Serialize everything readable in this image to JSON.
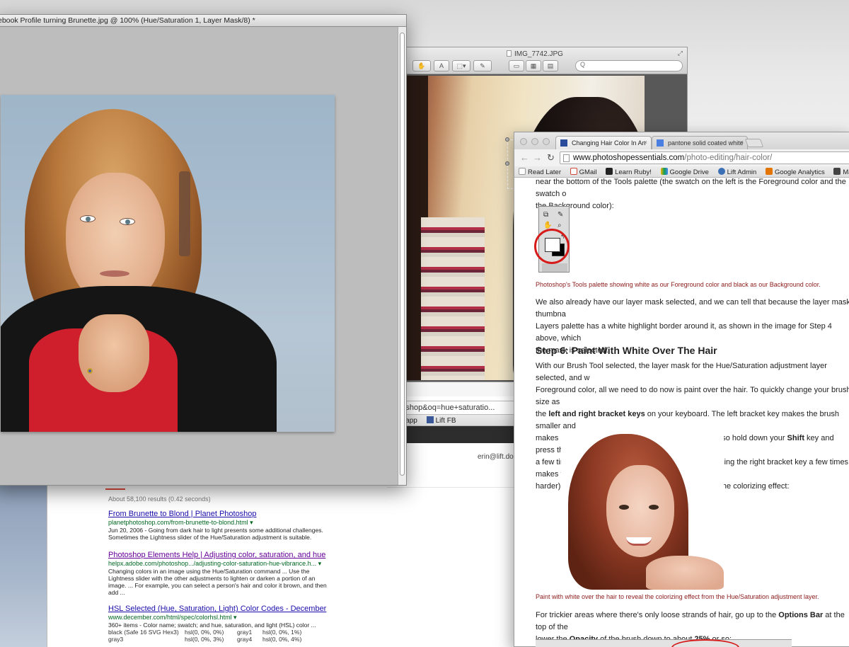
{
  "google": {
    "omnibox": "hotoshop&oq=hue+saturatio...",
    "bookmarks": [
      "@liftapp",
      "Lift FB"
    ],
    "user_email": "erin@lift.do",
    "results_count": "About 58,100 results (0.42 seconds)",
    "results": [
      {
        "title": "From Brunette to Blond | Planet Photoshop",
        "url": "planetphotoshop.com/from-brunette-to-blond.html ▾",
        "desc1": "Jun 20, 2006 - Going from dark hair to light presents some additional challenges.",
        "desc2": "Sometimes the Lightness slider of the Hue/Saturation adjustment is suitable.",
        "desc3": "",
        "desc4": ""
      },
      {
        "title": "Photoshop Elements Help | Adjusting color, saturation, and hue",
        "url": "helpx.adobe.com/photoshop.../adjusting-color-saturation-hue-vibrance.h... ▾",
        "desc1": "Changing colors in an image using the Hue/Saturation command ... Use the",
        "desc2": "Lightness slider with the other adjustments to lighten or darken a portion of an",
        "desc3": "image. ... For example, you can select a person's hair and color it brown, and then",
        "desc4": "add ..."
      },
      {
        "title": "HSL Selected (Hue, Saturation, Light) Color Codes - December",
        "url": "www.december.com/html/spec/colorhsl.html ▾",
        "desc1": "360+ items - Color name; swatch; and hue, saturation, and light (HSL) color ...",
        "desc2": "",
        "desc3": "",
        "desc4": ""
      }
    ],
    "table": [
      [
        "black (Safe 16 SVG Hex3)",
        "hsl(0, 0%, 0%)",
        "gray1",
        "hsl(0, 0%, 1%)"
      ],
      [
        "gray3",
        "hsl(0, 0%, 3%)",
        "gray4",
        "hsl(0, 0%, 4%)"
      ]
    ]
  },
  "preview": {
    "title": "IMG_7742.JPG",
    "search_placeholder": "Q"
  },
  "photoshop": {
    "title": "ebook Profile turning Brunette.jpg @ 100% (Hue/Saturation 1, Layer Mask/8) *"
  },
  "chrome": {
    "tabs": [
      {
        "label": "Changing Hair Color In An",
        "active": true
      },
      {
        "label": "pantone solid coated white",
        "active": false
      }
    ],
    "url_domain": "www.photoshopessentials.com",
    "url_path": "/photo-editing/hair-color/",
    "bookmarks": [
      "Read Later",
      "GMail",
      "Learn Ruby!",
      "Google Drive",
      "Lift Admin",
      "Google Analytics",
      "MailChim"
    ],
    "page": {
      "intro_text": "near the bottom of the Tools palette (the swatch on the left is the Foreground color and the swatch o",
      "intro_text2": "the Background color):",
      "caption1": "Photoshop's Tools palette showing white as our Foreground color and black as our Background color.",
      "para1_l1": "We also already have our layer mask selected, and we can tell that because the layer mask thumbna",
      "para1_l2": "Layers palette has a white highlight border around it, as shown in the image for Step 4 above, which",
      "para1_l3": "the mask is selected.",
      "step_heading": "Step 6: Paint With White Over The Hair",
      "para2_l1": "With our Brush Tool selected, the layer mask for the Hue/Saturation adjustment layer selected, and w",
      "para2_l2": "Foreground color, all we need to do now is paint over the hair. To quickly change your brush size as",
      "para2_l3a": "the ",
      "para2_l3b": "left and right bracket keys",
      "para2_l3c": " on your keyboard. The left bracket key makes the brush smaller and",
      "para2_l4": "makes it larger. You'll want to use a soft-edged brush, so hold down your ",
      "para2_l4b": "Shift",
      "para2_l4c": " key and press the ",
      "para2_l4d": "left",
      "para2_l5": "a few times to soften its edges (holding Shift and pressing the right bracket key a few times makes th",
      "para2_l6": "harder). Then simply paint over the hair to bring back the colorizing effect:",
      "caption2": "Paint with white over the hair to reveal the colorizing effect from the Hue/Saturation adjustment layer.",
      "para3_l1a": "For trickier areas where there's only loose strands of hair, go up to the ",
      "para3_l1b": "Options Bar",
      "para3_l1c": " at the top of the",
      "para3_l2a": "lower the ",
      "para3_l2b": "Opacity",
      "para3_l2c": " of the brush down to about ",
      "para3_l2d": "25%",
      "para3_l2e": " or so:"
    }
  }
}
